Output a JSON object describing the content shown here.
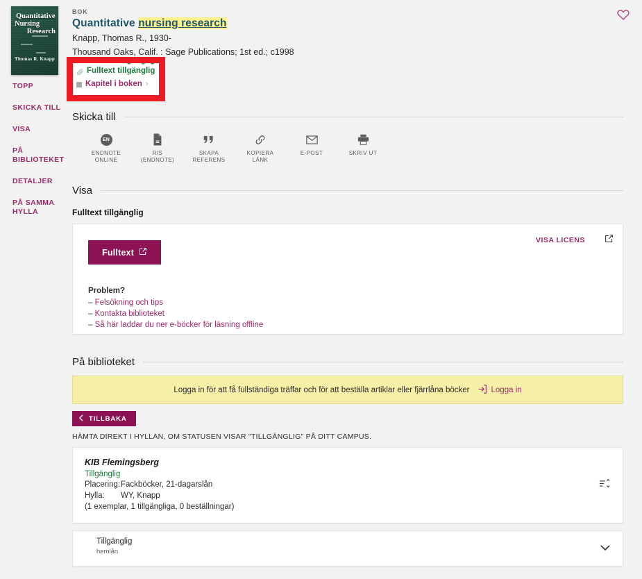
{
  "record": {
    "type_label": "BOK",
    "title_plain": "Quantitative ",
    "title_highlight": "nursing research",
    "author": "Knapp, Thomas R., 1930-",
    "imprint": "Thousand Oaks, Calif. : Sage Publications; 1st ed.; c1998",
    "favorite_icon": "heart-icon",
    "cover": {
      "line1": "Quantitative",
      "line2": "Nursing",
      "line3": "Research",
      "author": "Thomas R. Knapp"
    }
  },
  "sidenav": {
    "items": [
      {
        "label": "TOPP",
        "name": "sidebar-item-topp"
      },
      {
        "label": "SKICKA TILL",
        "name": "sidebar-item-skicka-till"
      },
      {
        "label": "VISA",
        "name": "sidebar-item-visa"
      },
      {
        "label": "PÅ\nBIBLIOTEKET",
        "name": "sidebar-item-pa-biblioteket"
      },
      {
        "label": "DETALJER",
        "name": "sidebar-item-detaljer"
      },
      {
        "label": "PÅ SAMMA\nHYLLA",
        "name": "sidebar-item-pa-samma-hylla"
      }
    ]
  },
  "availability": {
    "fulltext_label": "Fulltext tillgänglig",
    "chapter_label": "Kapitel i boken",
    "chevron": "›"
  },
  "sections": {
    "send_to": "Skicka till",
    "visa": "Visa",
    "library": "På biblioteket"
  },
  "send_to": {
    "items": [
      {
        "label": "ENDNOTE\nONLINE",
        "icon": "endnote-online-icon",
        "badge": "EN"
      },
      {
        "label": "RIS\n(ENDNOTE)",
        "icon": "ris-file-icon"
      },
      {
        "label": "SKAPA\nREFERENS",
        "icon": "quote-icon"
      },
      {
        "label": "KOPIERA\nLÄNK",
        "icon": "link-icon"
      },
      {
        "label": "E-POST",
        "icon": "envelope-icon"
      },
      {
        "label": "SKRIV UT",
        "icon": "printer-icon"
      }
    ]
  },
  "visa": {
    "subheading": "Fulltext tillgänglig",
    "license_label": "VISA LICENS",
    "license_icon": "external-link-icon",
    "fulltext_button": "Fulltext",
    "fulltext_button_icon": "external-link-icon",
    "problem_title": "Problem?",
    "problem_links": [
      "Felsökning och tips",
      "Kontakta biblioteket",
      "Så här laddar du ner e-böcker för läsning offline"
    ],
    "dash": "– "
  },
  "library": {
    "banner_text": "Logga in för att få fullständiga träffar och för att beställa artiklar eller fjärrlåna böcker",
    "banner_link": "Logga in",
    "banner_icon": "login-icon",
    "back_button": "TILLBAKA",
    "back_icon": "chevron-left-icon",
    "hint": "HÄMTA DIREKT I HYLLAN, OM STATUSEN VISAR \"TILLGÄNGLIG\" PÅ DITT CAMPUS.",
    "holding": {
      "name": "KIB Flemingsberg",
      "status": "Tillgänglig",
      "placering_label": "Placering:",
      "placering_value": "Fackböcker, 21-dagarslån",
      "hylla_label": "Hylla:",
      "hylla_value": "WY, Knapp",
      "counts": "(1 exemplar, 1 tillgängliga, 0 beställningar)",
      "sort_icon": "sort-list-icon"
    },
    "expand": {
      "title": "Tillgänglig",
      "subtitle": "hemlån",
      "chevron_icon": "chevron-down-icon"
    }
  }
}
